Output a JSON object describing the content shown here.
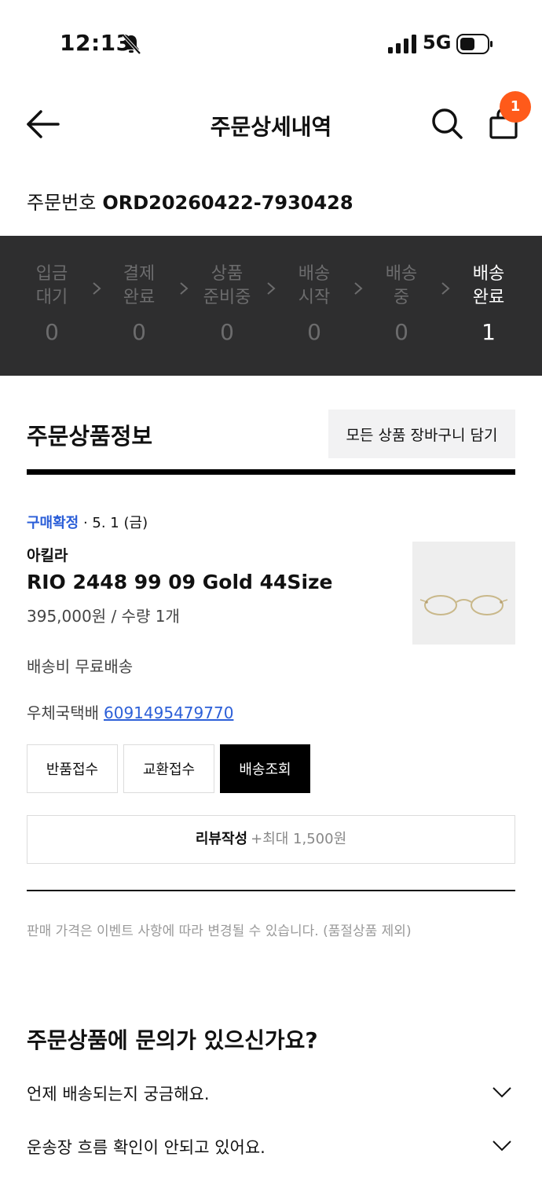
{
  "status_bar": {
    "time": "12:13",
    "network": "5G"
  },
  "header": {
    "title": "주문상세내역",
    "cart_badge": "1"
  },
  "order": {
    "label": "주문번호",
    "number": "ORD20260422-7930428"
  },
  "progress_steps": [
    {
      "label": "입금\n대기",
      "count": "0",
      "active": false
    },
    {
      "label": "결제\n완료",
      "count": "0",
      "active": false
    },
    {
      "label": "상품\n준비중",
      "count": "0",
      "active": false
    },
    {
      "label": "배송\n시작",
      "count": "0",
      "active": false
    },
    {
      "label": "배송\n중",
      "count": "0",
      "active": false
    },
    {
      "label": "배송\n완료",
      "count": "1",
      "active": true
    }
  ],
  "section": {
    "title": "주문상품정보",
    "cart_all_label": "모든 상품 장바구니 담기"
  },
  "item": {
    "status": "구매확정",
    "date": " · 5. 1 (금)",
    "brand": "아킬라",
    "name": "RIO 2448 99 09 Gold 44Size",
    "price_qty": "395,000원 / 수량 1개",
    "shipping_fee": "배송비 무료배송",
    "courier": "우체국택배",
    "tracking_number": "6091495479770",
    "thumbnail_icon": "eyeglasses-image"
  },
  "actions": {
    "return": "반품접수",
    "exchange": "교환접수",
    "track": "배송조회"
  },
  "review": {
    "label": "리뷰작성",
    "bonus": "+최대 1,500원"
  },
  "notice": "판매 가격은 이벤트 사항에 따라 변경될 수 있습니다. (품절상품 제외)",
  "faq": {
    "title": "주문상품에 문의가 있으신가요?",
    "items": [
      "언제 배송되는지 궁금해요.",
      "운송장 흐름 확인이 안되고 있어요."
    ]
  },
  "colors": {
    "accent_blue": "#2c5fd8",
    "badge_orange": "#ff5a1a",
    "progress_bg": "#2e2e2f"
  }
}
